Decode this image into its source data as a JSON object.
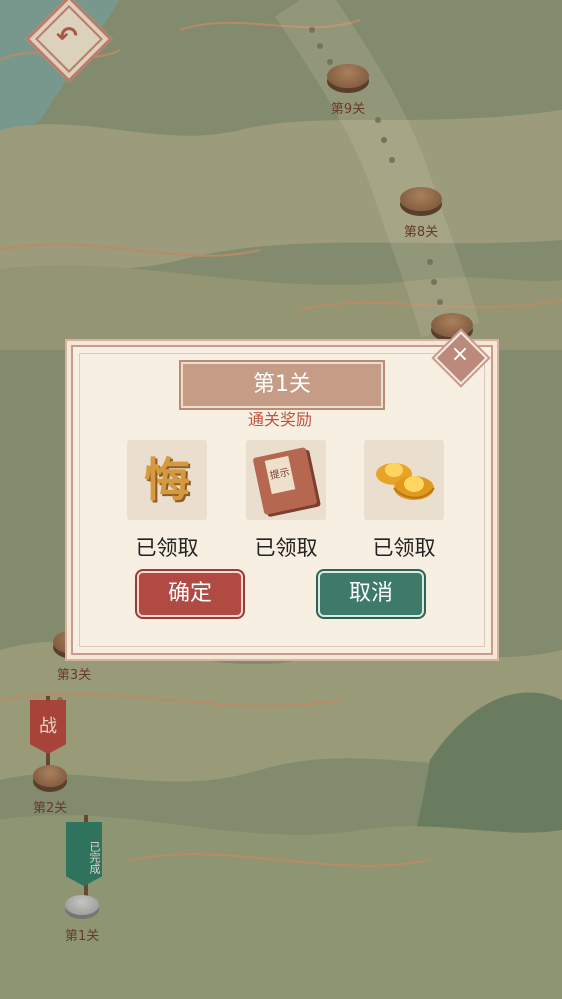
{
  "map": {
    "stages": [
      {
        "label": "第9关"
      },
      {
        "label": "第8关"
      },
      {
        "label": "第3关"
      },
      {
        "label": "第2关"
      },
      {
        "label": "第1关"
      }
    ],
    "flag_battle": "战",
    "flag_done": "已完成"
  },
  "dialog": {
    "title": "第1关",
    "subtitle": "通关奖励",
    "rewards": [
      {
        "icon": "regret-card-icon",
        "glyph": "悔",
        "status": "已领取"
      },
      {
        "icon": "hint-book-icon",
        "glyph": "提示",
        "status": "已领取"
      },
      {
        "icon": "gold-ingot-icon",
        "status": "已领取"
      }
    ],
    "confirm_label": "确定",
    "cancel_label": "取消",
    "close_glyph": "×"
  },
  "back_glyph": "↶",
  "colors": {
    "confirm": "#b04a43",
    "cancel": "#3d7a68",
    "accent_text": "#c0543f"
  }
}
